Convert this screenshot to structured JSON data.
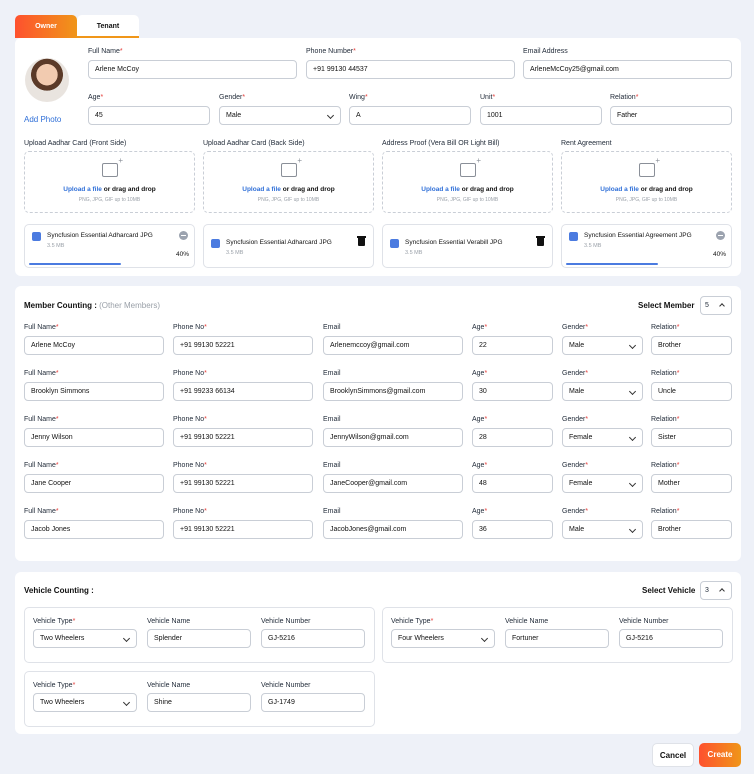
{
  "tabs": [
    "Owner",
    "Tenant"
  ],
  "owner": {
    "add_photo": "Add Photo",
    "full_name": {
      "label": "Full Name",
      "value": "Arlene McCoy"
    },
    "phone": {
      "label": "Phone Number",
      "value": "+91 99130 44537"
    },
    "email": {
      "label": "Email Address",
      "value": "ArleneMcCoy25@gmail.com"
    },
    "age": {
      "label": "Age",
      "value": "45"
    },
    "gender": {
      "label": "Gender",
      "value": "Male"
    },
    "wing": {
      "label": "Wing",
      "value": "A"
    },
    "unit": {
      "label": "Unit",
      "value": "1001"
    },
    "relation": {
      "label": "Relation",
      "value": "Father"
    }
  },
  "uploads": [
    {
      "label": "Upload Aadhar Card (Front Side)"
    },
    {
      "label": "Upload Aadhar Card (Back Side)"
    },
    {
      "label": "Address Proof (Vera Bill OR Light Bill)"
    },
    {
      "label": "Rent Agreement"
    }
  ],
  "upload_box": {
    "link": "Upload a file",
    "rest": " or drag and drop",
    "hint": "PNG, JPG, GIF up to 10MB"
  },
  "files": [
    {
      "name": "Syncfusion Essential Adharcard JPG",
      "size": "3.5 MB",
      "percent": "40%",
      "progress": 0.4,
      "action": "remove"
    },
    {
      "name": "Syncfusion Essential Adharcard JPG",
      "size": "3.5 MB",
      "percent": "",
      "progress": 0,
      "action": "delete"
    },
    {
      "name": "Syncfusion Essential Verabill JPG",
      "size": "3.5 MB",
      "percent": "",
      "progress": 0,
      "action": "delete"
    },
    {
      "name": "Syncfusion Essential  Agreement JPG",
      "size": "3.5 MB",
      "percent": "40%",
      "progress": 0.4,
      "action": "remove"
    }
  ],
  "members": {
    "title": "Member Counting :",
    "subtitle": "(Other Members)",
    "select_label": "Select Member",
    "count": "5",
    "labels": {
      "full_name": "Full Name",
      "phone": "Phone No",
      "email": "Email",
      "age": "Age",
      "gender": "Gender",
      "relation": "Relation"
    },
    "rows": [
      {
        "name": "Arlene McCoy",
        "phone": "+91 99130 52221",
        "email": "Arlenemccoy@gmail.com",
        "age": "22",
        "gender": "Male",
        "relation": "Brother"
      },
      {
        "name": "Brooklyn Simmons",
        "phone": "+91 99233 66134",
        "email": "BrooklynSimmons@gmail.com",
        "age": "30",
        "gender": "Male",
        "relation": "Uncle"
      },
      {
        "name": "Jenny Wilson",
        "phone": "+91 99130 52221",
        "email": "JennyWilson@gmail.com",
        "age": "28",
        "gender": "Female",
        "relation": "Sister"
      },
      {
        "name": "Jane Cooper",
        "phone": "+91 99130 52221",
        "email": "JaneCooper@gmail.com",
        "age": "48",
        "gender": "Female",
        "relation": "Mother"
      },
      {
        "name": "Jacob Jones",
        "phone": "+91 99130 52221",
        "email": "JacobJones@gmail.com",
        "age": "36",
        "gender": "Male",
        "relation": "Brother"
      }
    ]
  },
  "vehicles": {
    "title": "Vehicle Counting :",
    "select_label": "Select Vehicle",
    "count": "3",
    "labels": {
      "type": "Vehicle Type",
      "name": "Vehicle Name",
      "number": "Vehicle Number"
    },
    "items": [
      {
        "type": "Two Wheelers",
        "name": "Splender",
        "number": "GJ-5216"
      },
      {
        "type": "Four Wheelers",
        "name": "Fortuner",
        "number": "GJ-5216"
      },
      {
        "type": "Two Wheelers",
        "name": "Shine",
        "number": "GJ-1749"
      }
    ]
  },
  "actions": {
    "cancel": "Cancel",
    "create": "Create"
  },
  "colors": {
    "accent": "#fe512e",
    "link": "#2f6fd8",
    "progress": "#4b7be0"
  }
}
